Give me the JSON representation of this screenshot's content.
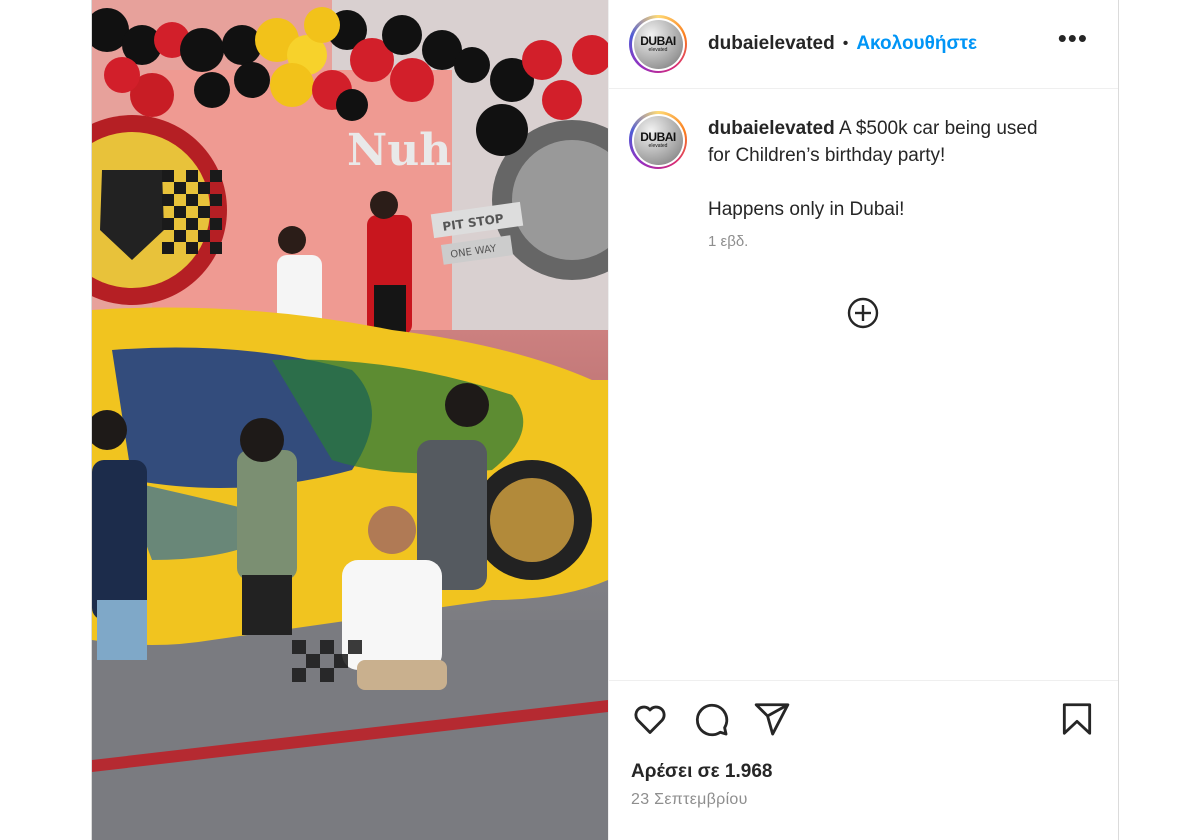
{
  "account": {
    "username": "dubaielevated",
    "logo_text": "DUBAI",
    "logo_subtext": "elevated"
  },
  "header": {
    "separator": "•",
    "follow_label": "Ακολουθήστε",
    "more_label": "•••"
  },
  "caption": {
    "username": "dubaielevated",
    "lines": [
      "A $500k car being used",
      "for Children’s birthday party!"
    ],
    "line2": "Happens only in Dubai!",
    "time": "1 εβδ."
  },
  "actions": {
    "likes": "Αρέσει σε 1.968",
    "date": "23 Σεπτεμβρίου"
  },
  "media": {
    "backdrop_text": "Nuh",
    "sign_pit_stop": "PIT STOP",
    "sign_one_way": "ONE WAY"
  },
  "colors": {
    "accent": "#0095f6",
    "text": "#262626",
    "secondary": "#8e8e8e",
    "border": "#dbdbdb"
  },
  "icons": [
    "heart-icon",
    "comment-icon",
    "share-icon",
    "bookmark-icon",
    "add-comment-icon",
    "more-icon"
  ]
}
